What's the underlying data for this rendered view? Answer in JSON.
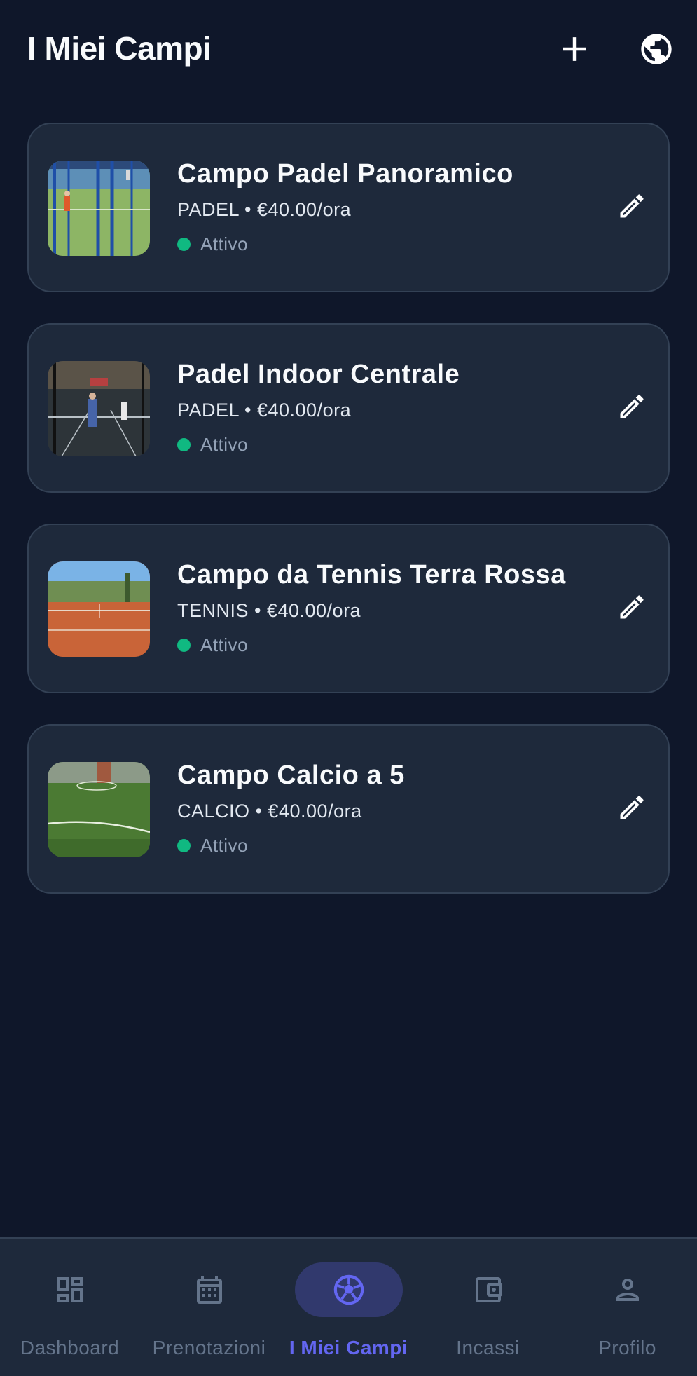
{
  "app_bar": {
    "title": "I Miei Campi",
    "add_icon": "plus-icon",
    "language_icon": "globe-icon"
  },
  "fields": [
    {
      "title": "Campo Padel Panoramico",
      "subtitle": "PADEL • €40.00/ora",
      "status": "Attivo",
      "thumb": "padel-court-photo"
    },
    {
      "title": "Padel Indoor Centrale",
      "subtitle": "PADEL • €40.00/ora",
      "status": "Attivo",
      "thumb": "indoor-padel-photo"
    },
    {
      "title": "Campo da Tennis Terra Rossa",
      "subtitle": "TENNIS • €40.00/ora",
      "status": "Attivo",
      "thumb": "clay-tennis-photo"
    },
    {
      "title": "Campo Calcio a 5",
      "subtitle": "CALCIO • €40.00/ora",
      "status": "Attivo",
      "thumb": "football-pitch-photo"
    }
  ],
  "nav": {
    "items": [
      {
        "label": "Dashboard",
        "icon": "dashboard-icon"
      },
      {
        "label": "Prenotazioni",
        "icon": "calendar-icon"
      },
      {
        "label": "I Miei Campi",
        "icon": "soccer-ball-icon"
      },
      {
        "label": "Incassi",
        "icon": "wallet-icon"
      },
      {
        "label": "Profilo",
        "icon": "person-icon"
      }
    ],
    "active": "I Miei Campi"
  },
  "colors": {
    "background": "#0f172a",
    "card": "#1e293b",
    "card_border": "#334155",
    "accent": "#6366f1",
    "status_active": "#10b981",
    "muted_text": "#94a3b8"
  }
}
